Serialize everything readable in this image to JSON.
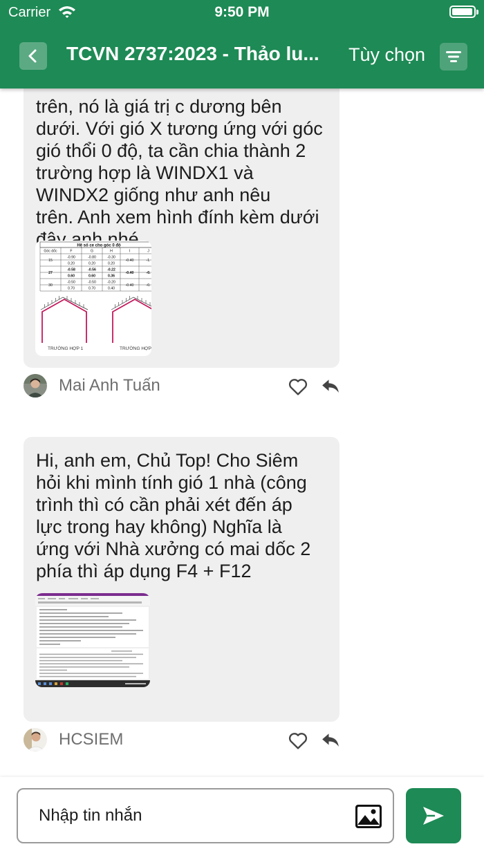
{
  "status_bar": {
    "carrier": "Carrier",
    "time": "9:50 PM",
    "battery_level": 0.95
  },
  "header": {
    "title": "TCVN 2737:2023 - Thảo lu...",
    "options_label": "Tùy chọn",
    "back_icon": "chevron-left-icon",
    "menu_icon": "menu-icon",
    "background_color": "#1e8a55"
  },
  "messages": [
    {
      "lines": [
        "trên, nó là giá trị c dương bên",
        "dưới. Với gió X tương ứng với góc",
        "gió thổi 0 độ, ta cần chia thành 2",
        "trường hợp là WINDX1 và",
        "WINDX2 giống như anh nêu",
        "trên. Anh xem hình đính kèm dưới",
        "đây anh nhé."
      ],
      "author": "Mai Anh Tuấn",
      "attachment": {
        "table_title": "Hệ số ce cho góc 0 độ",
        "headers": [
          "Góc dốc",
          "F",
          "G",
          "H",
          "I",
          "J"
        ],
        "rows": [
          [
            "15",
            "-0.90",
            "-0.80",
            "-0.30",
            "-0.40",
            "-1."
          ],
          [
            "",
            "0.20",
            "0.20",
            "0.20",
            "",
            ""
          ],
          [
            "27",
            "-0.58",
            "-0.56",
            "-0.22",
            "-0.40",
            "-0."
          ],
          [
            "",
            "0.60",
            "0.60",
            "0.36",
            "",
            ""
          ],
          [
            "30",
            "-0.50",
            "-0.50",
            "-0.20",
            "-0.40",
            "-0."
          ],
          [
            "",
            "0.70",
            "0.70",
            "0.40",
            "",
            ""
          ]
        ],
        "case1_label": "TRƯỜNG HỢP 1",
        "case2_label": "TRƯỜNG HỢP"
      }
    },
    {
      "lines": [
        "Hi, anh em, Chủ Top! Cho Siêm",
        "hỏi khi mình tính gió 1 nhà (công",
        "trình thì có cần phải xét đến áp",
        "lực trong hay không) Nghĩa là",
        "ứng với Nhà xưởng có mai dốc 2",
        "phía thì áp dụng F4 + F12"
      ],
      "author": "HCSIEM"
    }
  ],
  "composer": {
    "placeholder": "Nhập tin nhắn",
    "image_icon": "image-icon",
    "send_icon": "send-icon"
  }
}
